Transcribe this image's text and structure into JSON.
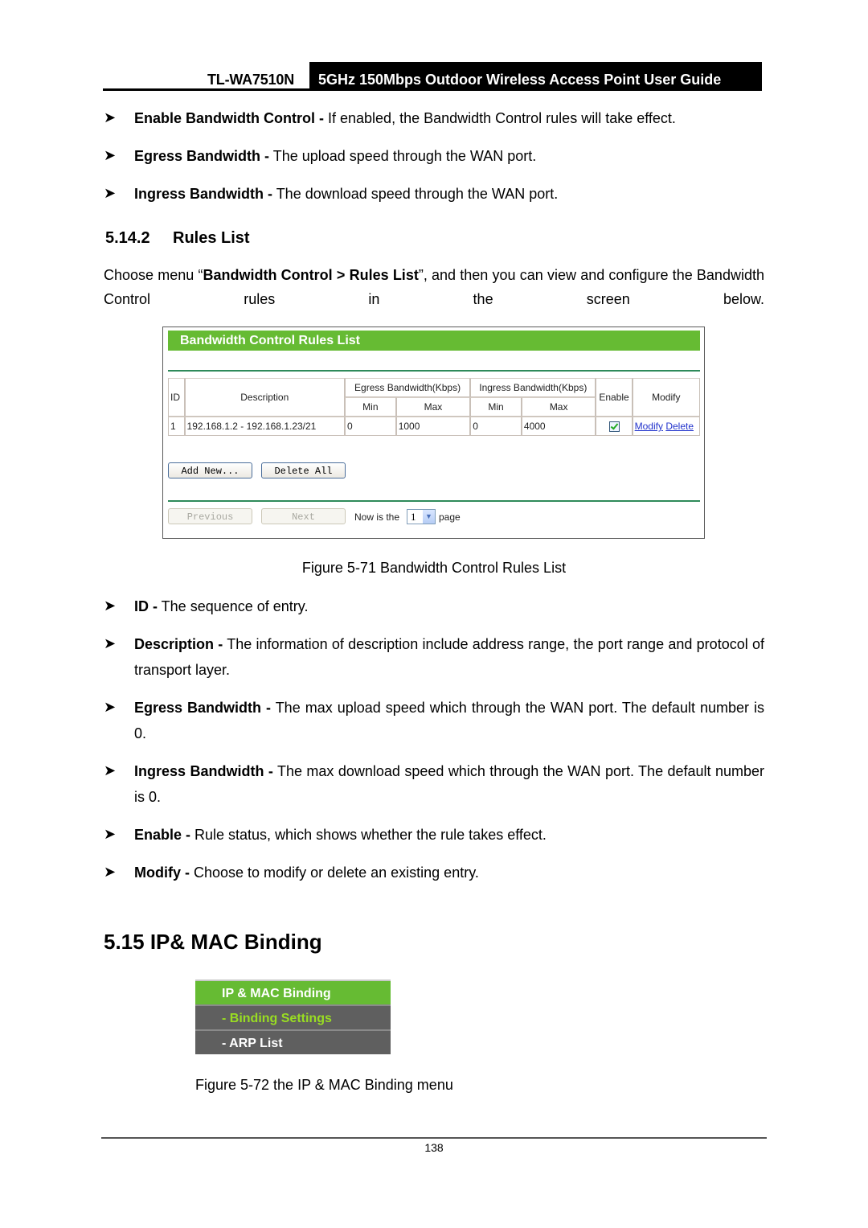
{
  "header": {
    "model": "TL-WA7510N",
    "guide_title": "5GHz 150Mbps Outdoor Wireless Access Point User Guide"
  },
  "intro_bullets": [
    {
      "term": "Enable Bandwidth Control -",
      "desc": " If enabled, the Bandwidth Control rules will take effect."
    },
    {
      "term": "Egress Bandwidth -",
      "desc": " The upload speed through the WAN port."
    },
    {
      "term": "Ingress Bandwidth -",
      "desc": " The download speed through the WAN port."
    }
  ],
  "section_5_14_2": {
    "number": "5.14.2",
    "title": "Rules List",
    "para_pre": "Choose menu “",
    "para_bold": "Bandwidth Control > Rules List",
    "para_post": "”, and then you can view and configure the Bandwidth Control rules in the screen below."
  },
  "figure_71": {
    "panel_title": "Bandwidth Control Rules List",
    "table": {
      "headers": {
        "id": "ID",
        "description": "Description",
        "egress": "Egress Bandwidth(Kbps)",
        "ingress": "Ingress Bandwidth(Kbps)",
        "enable": "Enable",
        "modify": "Modify",
        "min": "Min",
        "max": "Max"
      },
      "rows": [
        {
          "id": "1",
          "description": "192.168.1.2 - 192.168.1.23/21",
          "egress_min": "0",
          "egress_max": "1000",
          "ingress_min": "0",
          "ingress_max": "4000",
          "enabled": true,
          "modify_label": "Modify",
          "delete_label": "Delete"
        }
      ]
    },
    "buttons": {
      "add_new": "Add New...",
      "delete_all": "Delete All",
      "previous": "Previous",
      "next": "Next"
    },
    "pager": {
      "prefix": "Now is the",
      "current_page": "1",
      "suffix": "page"
    },
    "caption": "Figure 5-71 Bandwidth Control Rules List"
  },
  "field_bullets": [
    {
      "term": "ID -",
      "desc": " The sequence of entry."
    },
    {
      "term": "Description -",
      "desc": " The information of description include address range, the port range and protocol of transport layer."
    },
    {
      "term": "Egress Bandwidth -",
      "desc": " The max upload speed which through the WAN port. The default number is 0."
    },
    {
      "term": "Ingress Bandwidth -",
      "desc": " The max download speed which through the WAN port. The default number is 0."
    },
    {
      "term": "Enable -",
      "desc": " Rule status, which shows whether the rule takes effect."
    },
    {
      "term": "Modify -",
      "desc": " Choose to modify or delete an existing entry."
    }
  ],
  "section_5_15": {
    "title": "5.15 IP& MAC Binding"
  },
  "figure_72": {
    "menu": {
      "header": "IP & MAC Binding",
      "items": [
        {
          "label": "- Binding Settings",
          "active": true
        },
        {
          "label": "- ARP List",
          "active": false
        }
      ]
    },
    "caption": "Figure 5-72 the IP & MAC Binding menu"
  },
  "colors": {
    "menu_green": "#66bb33",
    "menu_gray": "#5f5f5f",
    "active_item": "#99dd22",
    "link_blue": "#2233cc"
  },
  "footer": {
    "page_number": "138"
  }
}
